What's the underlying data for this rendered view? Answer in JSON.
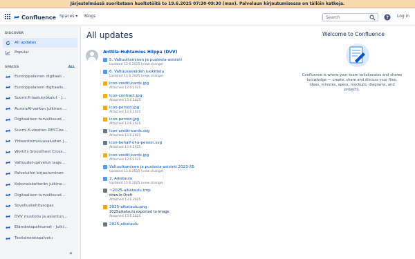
{
  "banner": {
    "text": "Järjestelmässä suoritetaan huoltotöitä to 19.6.2025 07:30-09:30 (max). Palveluun kirjautumisessa on tällöin katkoja."
  },
  "topnav": {
    "logo_text": "Confluence",
    "spaces_label": "Spaces ▾",
    "blogs_label": "Blogs",
    "search_placeholder": "Search",
    "login_label": "Log in"
  },
  "sidebar": {
    "discover_label": "DISCOVER",
    "discover_items": [
      {
        "label": "All updates",
        "icon": "refresh-icon",
        "active": true
      },
      {
        "label": "Popular",
        "icon": "chart-icon",
        "active": false
      }
    ],
    "spaces_label": "SPACES",
    "spaces_all_label": "ALL",
    "spaces": [
      "Eurooppalainen digitaali...",
      "Eurooppalaisen digitaalis...",
      "Suomi.fi-laatutyökalut - J...",
      "AuroraAI-verkon julkinen ...",
      "Digitaalisen turvallisuud...",
      "Suomi.fi-viestien REST-ke...",
      "Yhteentoimivuusalustan j...",
      "World's Smoothest Cross...",
      "Valtuudet-palvelun laaje...",
      "Palveluihin kirjautuminen",
      "Kokonaisketterän julkine...",
      "Digitaalisen turvallisuud...",
      "Sovelluskehitysopas",
      "DVV muotoilu ja asiantun...",
      "Elämäntapahtumat - Julki...",
      "Testiaineistopalvelu"
    ],
    "collapse_label": "«"
  },
  "main": {
    "title": "All updates",
    "author": "Anttila-Huhtamies Hilppa (DVV)",
    "updates": [
      {
        "title": "5. Valtuuttaminen ja puolesta-asiointi",
        "meta": "Updated 13.6.2025 (view change)",
        "type": "page"
      },
      {
        "title": "6. Valtuusasioiden luokittelu",
        "meta": "Updated 13.6.2025 (view change)",
        "type": "page"
      },
      {
        "title": "icon-credit-cards.jpg",
        "meta": "Attached 13.6.2025",
        "type": "image"
      },
      {
        "title": "icon-contract.jpg",
        "meta": "Attached 13.6.2025",
        "type": "image"
      },
      {
        "title": "icon-person.jpg",
        "meta": "Attached 13.6.2025",
        "type": "image"
      },
      {
        "title": "icon-person.jpg",
        "meta": "Attached 13.6.2025",
        "type": "image"
      },
      {
        "title": "icon-credit-cards.svg",
        "meta": "Attached 13.6.2025",
        "type": "file"
      },
      {
        "title": "icon-behalf-of-a-person.svg",
        "meta": "Attached 13.6.2025",
        "type": "file"
      },
      {
        "title": "icon-credit-cards.jpg",
        "meta": "Attached 13.6.2025",
        "type": "image"
      },
      {
        "title": "Valtuuttaminen ja puolesta-asiointi 2023-25",
        "meta": "Updated 13.6.2025 (view change)",
        "type": "page"
      },
      {
        "title": "2. Aikataulu",
        "meta": "Updated 13.6.2025 (view change)",
        "type": "page"
      },
      {
        "title": "~2025-aikataulu.tmp",
        "extra": "draw.io Draft",
        "meta": "Attached 13.6.2025",
        "type": "file"
      },
      {
        "title": "2025-aikataulu.png",
        "extra": "2025aikataulu exported to image",
        "meta": "Attached 13.6.2025",
        "type": "image"
      },
      {
        "title": "2025-aikataulu",
        "meta": "",
        "type": "file"
      }
    ]
  },
  "welcome": {
    "title": "Welcome to Confluence",
    "text": "Confluence is where your team collaborates and shares knowledge — create, share and discuss your files, ideas, minutes, specs, mockups, diagrams, and projects."
  },
  "colors": {
    "banner_bg": "#f8d8ad",
    "link": "#0052cc",
    "sidebar_bg": "#f4f5f7",
    "active_bg": "#deebff",
    "page_icon": "#4c9aff",
    "image_icon": "#ffab00",
    "file_icon": "#6b778c"
  }
}
